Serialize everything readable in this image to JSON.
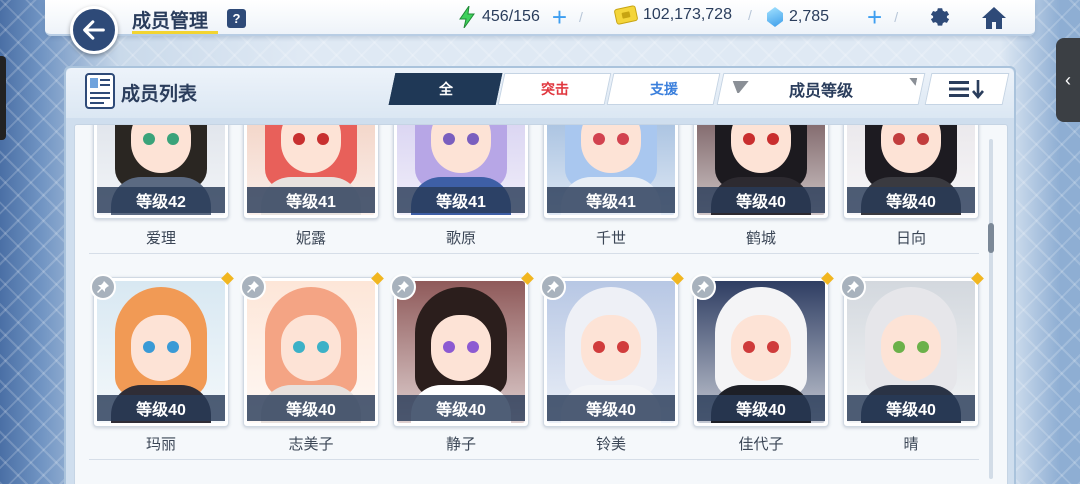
{
  "header": {
    "title": "成员管理",
    "help_label": "?",
    "ap": "456/156",
    "credits": "102,173,728",
    "gems": "2,785",
    "plus_label": "+",
    "sep": "/"
  },
  "panel": {
    "title": "成员列表",
    "tabs": [
      {
        "label": "全",
        "state": "active"
      },
      {
        "label": "突击",
        "state": "inactive"
      },
      {
        "label": "支援",
        "state": "inactive"
      }
    ],
    "sort_label": "成员等级",
    "side_tab_glyph": "‹"
  },
  "students_row1": [
    {
      "name": "爱理",
      "level": "等级42",
      "hair": "#2a2622",
      "eye": "#3aa37a",
      "body": "#5b6a82",
      "bg": "#d7dde6"
    },
    {
      "name": "妮露",
      "level": "等级41",
      "hair": "#e8605a",
      "eye": "#c83030",
      "body": "#e7e2de",
      "bg": "#f0c9b8"
    },
    {
      "name": "歌原",
      "level": "等级41",
      "hair": "#b7a6e6",
      "eye": "#7a5fbf",
      "body": "#3e5fa6",
      "bg": "#cfc8ee"
    },
    {
      "name": "千世",
      "level": "等级41",
      "hair": "#a9c7ef",
      "eye": "#d2424f",
      "body": "#e8eef6",
      "bg": "#8fb0d8"
    },
    {
      "name": "鹤城",
      "level": "等级40",
      "hair": "#1c1a1f",
      "eye": "#c92e2e",
      "body": "#2d2a30",
      "bg": "#5a3a3e"
    },
    {
      "name": "日向",
      "level": "等级40",
      "hair": "#1d1b21",
      "eye": "#c23d3d",
      "body": "#3a3a40",
      "bg": "#e4e1e6"
    }
  ],
  "students_row2": [
    {
      "name": "玛丽",
      "level": "等级40",
      "hair": "#f19a55",
      "eye": "#3a9ad6",
      "body": "#2f2d36",
      "bg": "#d8e8f2"
    },
    {
      "name": "志美子",
      "level": "等级40",
      "hair": "#f4a484",
      "eye": "#3cb1c7",
      "body": "#e8e0dc",
      "bg": "#fde6d8"
    },
    {
      "name": "静子",
      "level": "等级40",
      "hair": "#2b1e1c",
      "eye": "#8c5ad2",
      "body": "#ffffff",
      "bg": "#8f5a5a"
    },
    {
      "name": "铃美",
      "level": "等级40",
      "hair": "#eef0f6",
      "eye": "#d13c3c",
      "body": "#f4f5f8",
      "bg": "#b7c7e4"
    },
    {
      "name": "佳代子",
      "level": "等级40",
      "hair": "#f4f4f6",
      "eye": "#cf3b3b",
      "body": "#1d1f26",
      "bg": "#2f3e63"
    },
    {
      "name": "晴",
      "level": "等级40",
      "hair": "#e6e6ea",
      "eye": "#6bb14a",
      "body": "#2a3345",
      "bg": "#d3d8de"
    }
  ],
  "colors": {
    "accent_dark": "#1f3856",
    "assault": "#e0373f",
    "support": "#3a7fdc",
    "underline": "#f2d431",
    "plus": "#3e9ef0"
  }
}
